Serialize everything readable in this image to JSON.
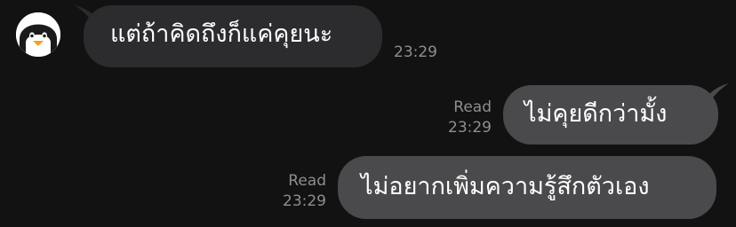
{
  "colors": {
    "background": "#121212",
    "incoming_bubble": "#2c2c2e",
    "outgoing_bubble": "#4a4a4c",
    "meta_text": "#8e8e93",
    "text": "#ffffff"
  },
  "messages": [
    {
      "direction": "incoming",
      "text": "แต่ถ้าคิดถึงก็แค่คุยนะ",
      "time": "23:29",
      "avatar_icon": "penguin-icon"
    },
    {
      "direction": "outgoing",
      "text": "ไม่คุยดีกว่ามั้ง",
      "read": "Read",
      "time": "23:29"
    },
    {
      "direction": "outgoing",
      "text": "ไม่อยากเพิ่มความรู้สึกตัวเอง",
      "read": "Read",
      "time": "23:29"
    }
  ]
}
